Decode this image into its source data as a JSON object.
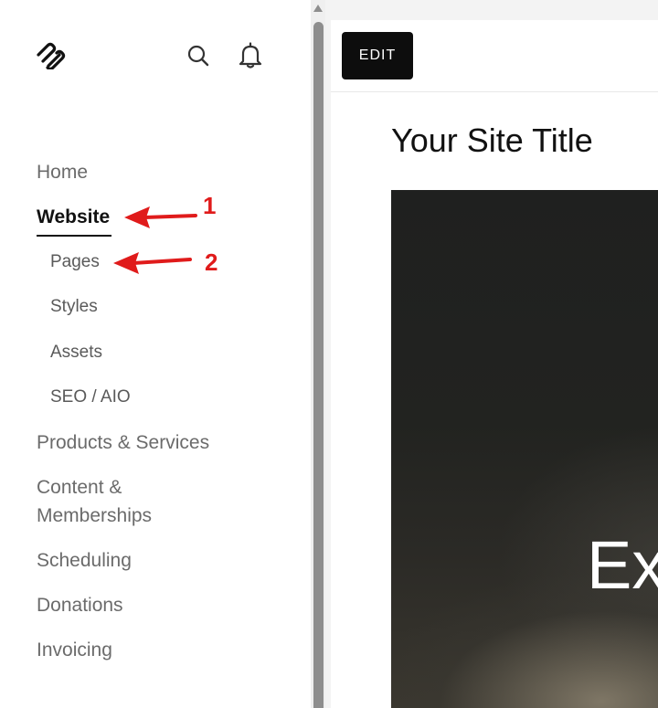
{
  "sidebar": {
    "logo": "squarespace-logo",
    "icons": [
      "search-icon",
      "bell-icon"
    ],
    "nav": {
      "home": "Home",
      "website": "Website",
      "pages": "Pages",
      "styles": "Styles",
      "assets": "Assets",
      "seo": "SEO / AIO",
      "products": "Products & Services",
      "content_line1": "Content &",
      "content_line2": "Memberships",
      "scheduling": "Scheduling",
      "donations": "Donations",
      "invoicing": "Invoicing"
    }
  },
  "annotations": {
    "step1": "1",
    "step2": "2",
    "color": "#e01b1b"
  },
  "preview": {
    "edit_label": "EDIT",
    "site_title": "Your Site Title",
    "hero_text": "Ex"
  }
}
